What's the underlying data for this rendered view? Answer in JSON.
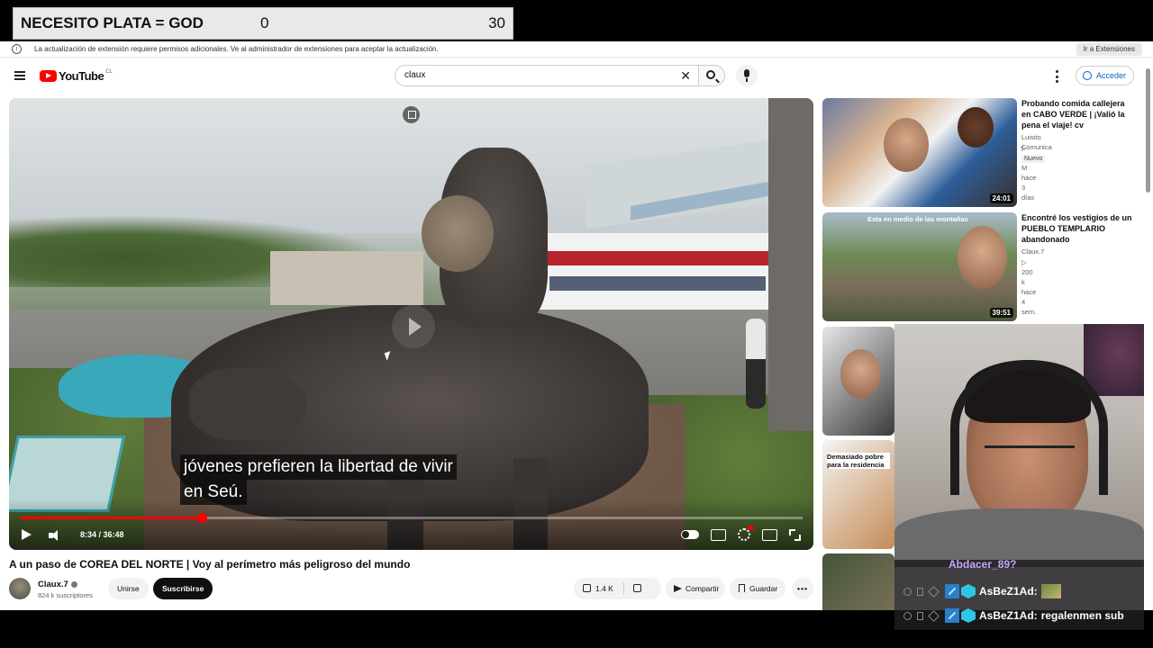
{
  "stream_goal": {
    "title": "NECESITO PLATA = GOD",
    "current": "0",
    "target": "30"
  },
  "extension_bar": {
    "message": "La actualización de extensión requiere permisos adicionales. Ve al administrador de extensiones para aceptar la actualización.",
    "button": "Ir a Extensiones"
  },
  "header": {
    "logo_text": "YouTube",
    "logo_country": "CL",
    "search_value": "claux",
    "signin_label": "Acceder"
  },
  "player": {
    "subtitle_line1": "jóvenes prefieren la libertad de vivir",
    "subtitle_line2": "en Seú.",
    "time_display": "8:34 / 36:48",
    "progress_fraction": 0.2328
  },
  "video": {
    "title": "A un paso de COREA DEL NORTE | Voy al perímetro más peligroso del mundo",
    "channel_name": "Claux.7",
    "subscribers": "824 k suscriptores",
    "join_label": "Unirse",
    "subscribe_label": "Suscribirse",
    "likes": "1.4 K",
    "share_label": "Compartir",
    "save_label": "Guardar",
    "more_label": "•••"
  },
  "recommendations": [
    {
      "title": "Probando comida callejera en CABO VERDE | ¡Valió la pena el viaje! cv",
      "channel": "Luisito Comunica",
      "meta": "▷ 5.4 M  hace 3 días",
      "badge": "Nuevo",
      "duration": "24:01"
    },
    {
      "title": "Encontré los vestigios de un PUEBLO TEMPLARIO abandonado",
      "channel": "Claux.7",
      "meta": "▷ 200 k  hace 4 sem.",
      "duration": "39:51",
      "thumb_text": "Esta en medio de las montañas"
    },
    {
      "thumb_text": ""
    },
    {
      "thumb_text": "Demasiado pobre para la residencia"
    }
  ],
  "chat": [
    {
      "user": "Abdacer_89?",
      "partial": true
    },
    {
      "user": "AsBeZ1Ad:",
      "text": "",
      "emote": true
    },
    {
      "user": "AsBeZ1Ad:",
      "text": "regalenmen sub"
    }
  ]
}
